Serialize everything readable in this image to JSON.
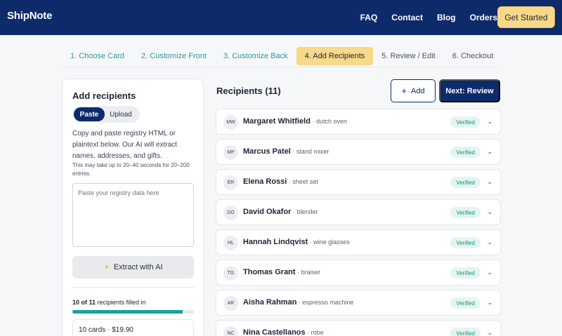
{
  "header": {
    "logo": "ShipNote",
    "nav": [
      "FAQ",
      "Contact",
      "Blog",
      "Orders"
    ],
    "cta": "Get Started"
  },
  "steps": [
    {
      "label": "1. Choose Card",
      "state": "done"
    },
    {
      "label": "2. Customize Front",
      "state": "done"
    },
    {
      "label": "3. Customize Back",
      "state": "done"
    },
    {
      "label": "4. Add Recipients",
      "state": "active"
    },
    {
      "label": "5. Review / Edit",
      "state": "future"
    },
    {
      "label": "6. Checkout",
      "state": "future"
    }
  ],
  "left": {
    "title": "Add recipients",
    "toggle": {
      "paste": "Paste",
      "upload": "Upload",
      "selected": "Paste"
    },
    "description": "Copy and paste registry HTML or plaintext below. Our AI will extract names, addresses, and gifts.",
    "note": "This may take up to 20–40 seconds for 20–200 entries.",
    "textarea_placeholder": "Paste your registry data here",
    "extract_label": "Extract with AI",
    "progress": {
      "filled": 10,
      "total": 11,
      "bold": "10 of 11",
      "suffix": " recipients filled in"
    },
    "summary": "10 cards · $19.90"
  },
  "recipients": {
    "title": "Recipients (11)",
    "add_label": "Add",
    "next_label": "Next: Review",
    "items": [
      {
        "initials": "MW",
        "name": "Margaret Whitfield",
        "gift": " · dutch oven",
        "status": "Verified"
      },
      {
        "initials": "MP",
        "name": "Marcus Patel",
        "gift": " · stand mixer",
        "status": "Verified"
      },
      {
        "initials": "ER",
        "name": "Elena Rossi",
        "gift": " · sheet set",
        "status": "Verified"
      },
      {
        "initials": "DO",
        "name": "David Okafor",
        "gift": " · blender",
        "status": "Verified"
      },
      {
        "initials": "HL",
        "name": "Hannah Lindqvist",
        "gift": " · wine glasses",
        "status": "Verified"
      },
      {
        "initials": "TG",
        "name": "Thomas Grant",
        "gift": " · braiser",
        "status": "Verified"
      },
      {
        "initials": "AR",
        "name": "Aisha Rahman",
        "gift": " · espresso machine",
        "status": "Verified"
      },
      {
        "initials": "NC",
        "name": "Nina Castellanos",
        "gift": " · robe",
        "status": "Verified"
      }
    ]
  },
  "colors": {
    "navy": "#0d2a6b",
    "accent_yellow": "#f8d98a",
    "teal": "#18a39a",
    "verified_bg": "#e3f5f1",
    "verified_text": "#1e8c7e"
  }
}
